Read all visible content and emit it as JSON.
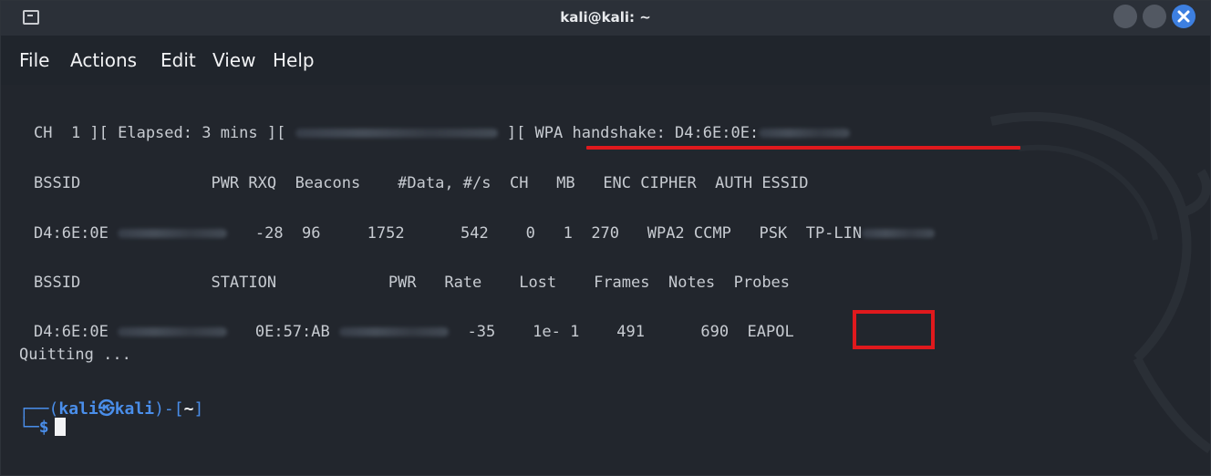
{
  "window": {
    "title": "kali@kali: ~",
    "close_color": "#3d7fe0"
  },
  "menu": {
    "file": "File",
    "actions": "Actions",
    "edit": "Edit",
    "view": "View",
    "help": "Help"
  },
  "status_line": {
    "ch_text": "CH  1 ][ Elapsed: 3 mins ][ ",
    "handshake_text": "][ WPA handshake: D4:6E:0E:"
  },
  "ap_table": {
    "header": "BSSID              PWR RXQ  Beacons    #Data, #/s  CH   MB   ENC CIPHER  AUTH ESSID",
    "bssid": "D4:6E:0E",
    "values": "-28  96     1752      542    0   1  270   WPA2 CCMP   PSK  TP-LIN"
  },
  "station_table": {
    "header": "BSSID              STATION            PWR   Rate    Lost    Frames  Notes  Probes",
    "bssid": "D4:6E:0E",
    "station": "0E:57:AB",
    "values": "-35    1e- 1    491      690  ",
    "notes": "EAPOL"
  },
  "quitting": "Quitting ...",
  "prompt": {
    "open": "┌──(",
    "user": "kali",
    "at": "㉿",
    "host": "kali",
    "close": ")-[",
    "dir": "~",
    "end": "]",
    "line2": "└─",
    "dollar": "$"
  },
  "highlight_color": "#e0191d"
}
